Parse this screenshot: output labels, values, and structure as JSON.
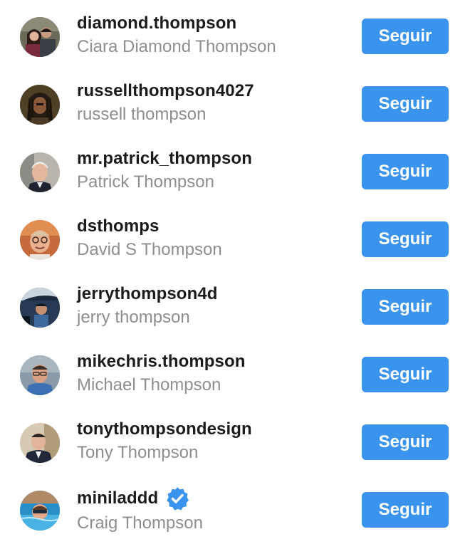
{
  "colors": {
    "button_bg": "#3a94ed",
    "username": "#1b1b1b",
    "fullname": "#8e8e8e",
    "verified": "#3a94ed"
  },
  "users": [
    {
      "username": "diamond.thompson",
      "full_name": "Ciara Diamond Thompson",
      "button": "Seguir",
      "verified": false,
      "avatar_icon": "couple-photo-avatar"
    },
    {
      "username": "russellthompson4027",
      "full_name": "russell thompson",
      "button": "Seguir",
      "verified": false,
      "avatar_icon": "man-dreadlocks-avatar"
    },
    {
      "username": "mr.patrick_thompson",
      "full_name": "Patrick Thompson",
      "button": "Seguir",
      "verified": false,
      "avatar_icon": "man-gray-hair-avatar"
    },
    {
      "username": "dsthomps",
      "full_name": "David S Thompson",
      "button": "Seguir",
      "verified": false,
      "avatar_icon": "man-glasses-avatar"
    },
    {
      "username": "jerrythompson4d",
      "full_name": "jerry thompson",
      "button": "Seguir",
      "verified": false,
      "avatar_icon": "man-in-car-avatar"
    },
    {
      "username": "mikechris.thompson",
      "full_name": "Michael Thompson",
      "button": "Seguir",
      "verified": false,
      "avatar_icon": "man-blue-shirt-avatar"
    },
    {
      "username": "tonythompsondesign",
      "full_name": "Tony Thompson",
      "button": "Seguir",
      "verified": false,
      "avatar_icon": "man-suit-avatar"
    },
    {
      "username": "miniladdd",
      "full_name": "Craig Thompson",
      "button": "Seguir",
      "verified": true,
      "avatar_icon": "man-in-pool-avatar"
    }
  ]
}
